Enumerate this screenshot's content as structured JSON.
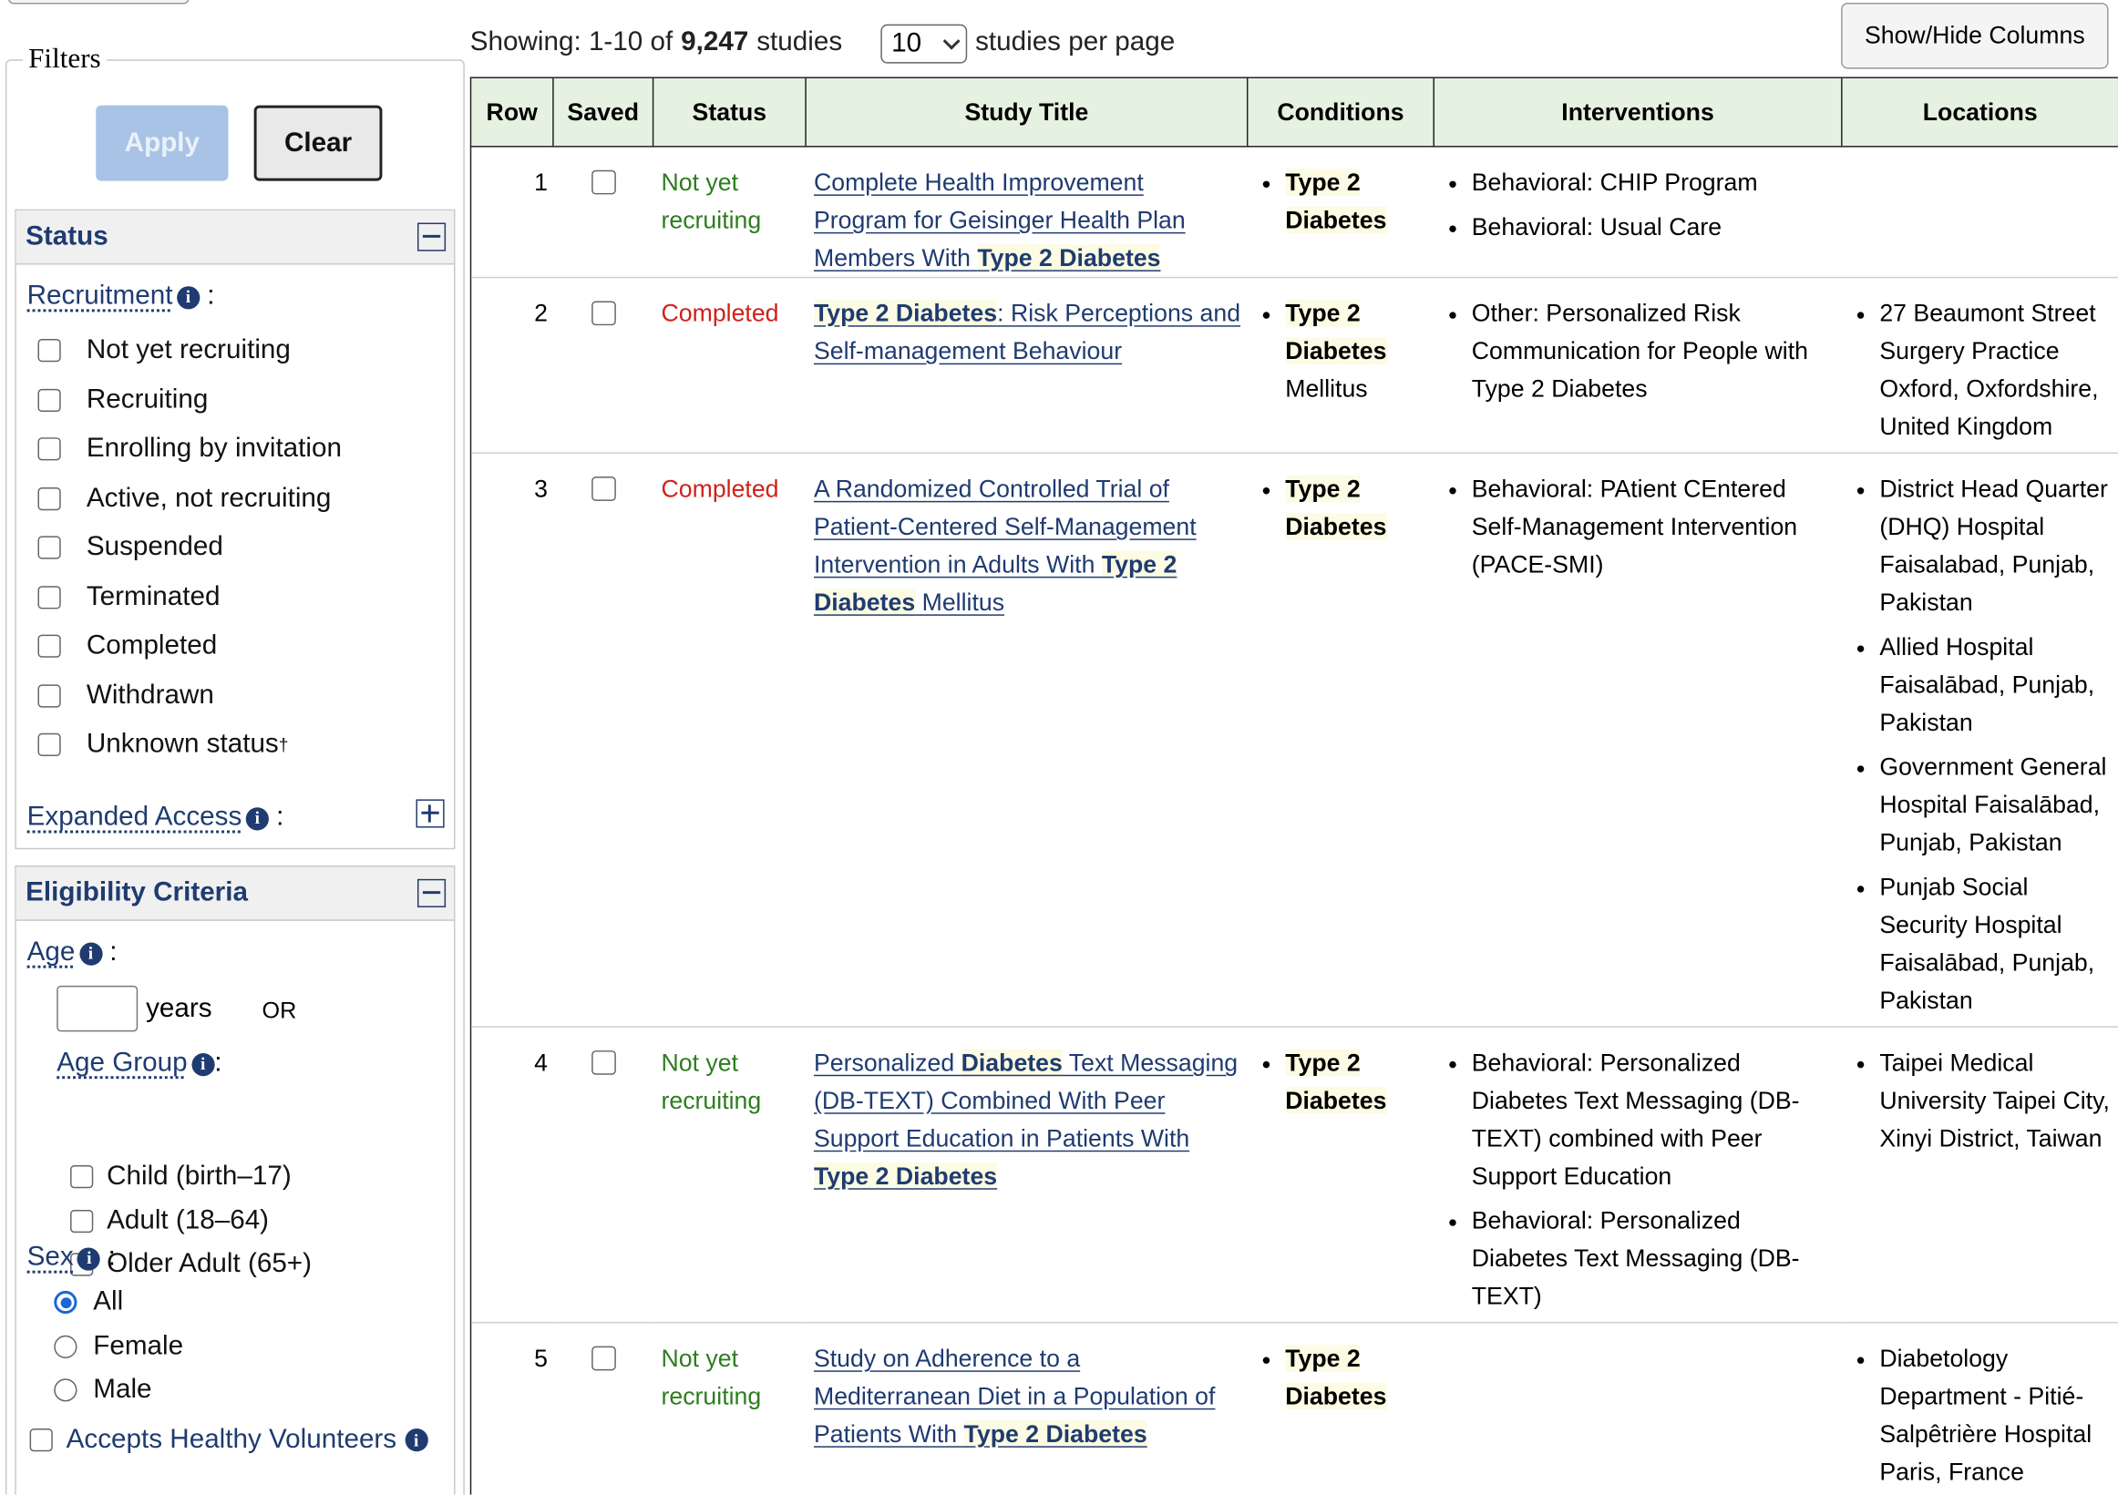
{
  "filters": {
    "legend": "Filters",
    "apply_label": "Apply",
    "clear_label": "Clear",
    "status_section": {
      "title": "Status",
      "recruitment_label": "Recruitment",
      "options": [
        "Not yet recruiting",
        "Recruiting",
        "Enrolling by invitation",
        "Active, not recruiting",
        "Suspended",
        "Terminated",
        "Completed",
        "Withdrawn",
        "Unknown status"
      ],
      "unknown_mark": "†",
      "expanded_access_label": "Expanded Access"
    },
    "eligibility_section": {
      "title": "Eligibility Criteria",
      "age_label": "Age",
      "years_label": "years",
      "or_label": "OR",
      "age_group_label": "Age Group",
      "age_groups": [
        "Child (birth–17)",
        "Adult (18–64)",
        "Older Adult (65+)"
      ],
      "sex_label": "Sex",
      "sex_options": [
        "All",
        "Female",
        "Male"
      ],
      "sex_selected": "All",
      "healthy_volunteers_label": "Accepts Healthy Volunteers"
    }
  },
  "results": {
    "showing_prefix": "Showing: 1-10 of",
    "total": "9,247",
    "showing_suffix": "studies",
    "per_page_value": "10",
    "per_page_label": "studies per page",
    "show_hide_label": "Show/Hide Columns",
    "columns": [
      "Row",
      "Saved",
      "Status",
      "Study Title",
      "Conditions",
      "Interventions",
      "Locations"
    ],
    "rows": [
      {
        "row": "1",
        "status": "Not yet recruiting",
        "status_color": "#2e7d1f",
        "title_parts": [
          "Complete Health Improvement Program for Geisinger Health Plan Members With ",
          "Type 2 Diabetes"
        ],
        "conditions": [
          [
            "Type 2 Diabetes",
            ""
          ]
        ],
        "interventions": [
          "Behavioral: CHIP Program",
          "Behavioral: Usual Care"
        ],
        "locations": []
      },
      {
        "row": "2",
        "status": "Completed",
        "status_color": "#d0211c",
        "title_parts": [
          "",
          "Type 2 Diabetes",
          ": Risk Perceptions and Self-management Behaviour"
        ],
        "conditions": [
          [
            "Type 2 Diabetes",
            "Mellitus"
          ]
        ],
        "interventions": [
          "Other: Personalized Risk Communication for People with Type 2 Diabetes"
        ],
        "locations": [
          "27 Beaumont Street Surgery Practice Oxford, Oxfordshire, United Kingdom"
        ]
      },
      {
        "row": "3",
        "status": "Completed",
        "status_color": "#d0211c",
        "title_parts": [
          "A Randomized Controlled Trial of Patient-Centered Self-Management Intervention in Adults With ",
          "Type 2 Diabetes",
          " Mellitus"
        ],
        "conditions": [
          [
            "Type 2 Diabetes",
            ""
          ]
        ],
        "interventions": [
          "Behavioral: PAtient CEntered Self-Management Intervention (PACE-SMI)"
        ],
        "locations": [
          "District Head Quarter (DHQ) Hospital Faisalabad, Punjab, Pakistan",
          "Allied Hospital Faisalābad, Punjab, Pakistan",
          "Government General Hospital Faisalābad, Punjab, Pakistan",
          "Punjab Social Security Hospital Faisalābad, Punjab, Pakistan"
        ]
      },
      {
        "row": "4",
        "status": "Not yet recruiting",
        "status_color": "#2e7d1f",
        "title_parts": [
          "Personalized ",
          "Diabetes",
          " Text Messaging (DB-TEXT) Combined With Peer Support Education in Patients With ",
          "Type 2 Diabetes"
        ],
        "conditions": [
          [
            "Type 2 Diabetes",
            ""
          ]
        ],
        "interventions": [
          "Behavioral: Personalized Diabetes Text Messaging (DB-TEXT) combined with Peer Support Education",
          "Behavioral: Personalized Diabetes Text Messaging (DB-TEXT)"
        ],
        "locations": [
          "Taipei Medical University Taipei City, Xinyi District, Taiwan"
        ]
      },
      {
        "row": "5",
        "status": "Not yet recruiting",
        "status_color": "#2e7d1f",
        "title_parts": [
          "Study on Adherence to a Mediterranean Diet in a Population of Patients With ",
          "Type 2 Diabetes"
        ],
        "conditions": [
          [
            "Type 2 Diabetes",
            ""
          ]
        ],
        "interventions": [],
        "locations": [
          "Diabetology Department - Pitié-Salpêtrière Hospital Paris, France"
        ]
      }
    ]
  }
}
